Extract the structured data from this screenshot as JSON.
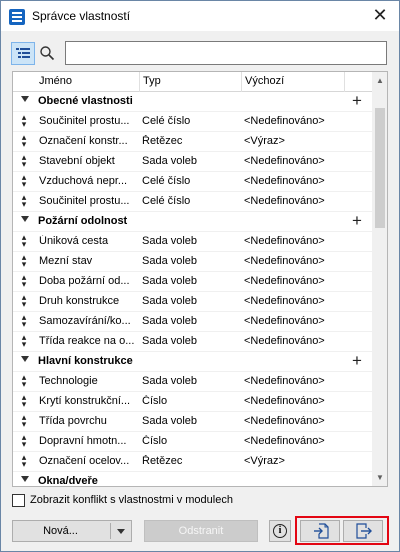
{
  "window": {
    "title": "Správce vlastností",
    "close_glyph": "✕"
  },
  "toolbar": {
    "tree_icon": "tree-list-icon",
    "search_icon": "search-icon",
    "search_value": ""
  },
  "grid": {
    "columns": [
      "Jméno",
      "Typ",
      "Výchozí"
    ],
    "groups": [
      {
        "label": "Obecné vlastnosti",
        "rows": [
          {
            "name": "Součinitel prostu...",
            "type": "Celé číslo",
            "default": "<Nedefinováno>"
          },
          {
            "name": "Označení konstr...",
            "type": "Řetězec",
            "default": "<Výraz>"
          },
          {
            "name": "Stavební objekt",
            "type": "Sada voleb",
            "default": "<Nedefinováno>"
          },
          {
            "name": "Vzduchová nepr...",
            "type": "Celé číslo",
            "default": "<Nedefinováno>"
          },
          {
            "name": "Součinitel prostu...",
            "type": "Celé číslo",
            "default": "<Nedefinováno>"
          }
        ]
      },
      {
        "label": "Požární odolnost",
        "rows": [
          {
            "name": "Úniková cesta",
            "type": "Sada voleb",
            "default": "<Nedefinováno>"
          },
          {
            "name": "Mezní stav",
            "type": "Sada voleb",
            "default": "<Nedefinováno>"
          },
          {
            "name": "Doba požární od...",
            "type": "Sada voleb",
            "default": "<Nedefinováno>"
          },
          {
            "name": "Druh konstrukce",
            "type": "Sada voleb",
            "default": "<Nedefinováno>"
          },
          {
            "name": "Samozavírání/ko...",
            "type": "Sada voleb",
            "default": "<Nedefinováno>"
          },
          {
            "name": "Třída reakce na o...",
            "type": "Sada voleb",
            "default": "<Nedefinováno>"
          }
        ]
      },
      {
        "label": "Hlavní konstrukce",
        "rows": [
          {
            "name": "Technologie",
            "type": "Sada voleb",
            "default": "<Nedefinováno>"
          },
          {
            "name": "Krytí konstrukční...",
            "type": "Číslo",
            "default": "<Nedefinováno>"
          },
          {
            "name": "Třída povrchu",
            "type": "Sada voleb",
            "default": "<Nedefinováno>"
          },
          {
            "name": "Dopravní hmotn...",
            "type": "Číslo",
            "default": "<Nedefinováno>"
          },
          {
            "name": "Označení ocelov...",
            "type": "Řetězec",
            "default": "<Výraz>"
          }
        ]
      },
      {
        "label": "Okna/dveře",
        "rows": []
      }
    ]
  },
  "options": {
    "conflict_label": "Zobrazit konflikt s vlastnostmi v modulech",
    "conflict_checked": false
  },
  "footer": {
    "new_label": "Nová...",
    "remove_label": "Odstranit",
    "info_glyph": "i",
    "import_icon": "import-icon",
    "export_icon": "export-icon",
    "highlight_color": "#e30613"
  }
}
